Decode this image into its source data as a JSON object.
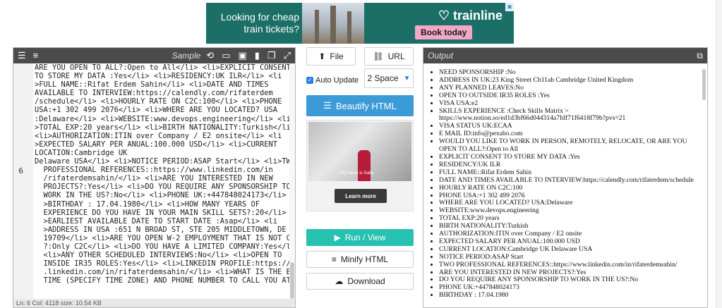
{
  "ad": {
    "text": "Looking for cheap train tickets?",
    "brand": "trainline",
    "cta": "Book today",
    "close_symbol": "✖"
  },
  "editor": {
    "sample_label": "Sample",
    "line_number": "6",
    "status": "Ln: 6   Col: 4118   size: 10.54 KB",
    "code_lines": [
      "ARE YOU OPEN TO ALL?:Open to All</li> <li>EXPLICIT CONSENT",
      "TO STORE MY DATA :Yes</li> <li>RESIDENCY:UK ILR</li> <li",
      ">FULL NAME::Rifat Erdem Sahin</li> <li>DATE AND TIMES",
      "AVAILABLE TO INTERVIEW:https://calendly.com/rifaterdem",
      "/schedule</li> <li>HOURLY RATE ON C2C:100</li> <li>PHONE",
      "USA:+1 302 499 2076</li> <li>WHERE ARE YOU LOCATED? USA",
      ":Delaware</li> <li>WEBSITE:www.devops.engineering</li> <li",
      ">TOTAL EXP:20 years</li> <li>BIRTH NATIONALITY:Turkish</li>",
      "<li>AUTHORIZATION:ITIN over Company / E2 onsite</li> <li",
      ">EXPECTED SALARY PER ANUAL:100.000 USD</li> <li>CURRENT",
      "LOCATION:Cambridge UK",
      "Delaware USA</li> <li>NOTICE PERIOD:ASAP Start</li> <li>TWO",
      "  PROFESSIONAL REFERENCES::https://www.linkedin.com/in",
      "  /rifaterdemsahin/</li> <li>ARE YOU INTERESTED IN NEW",
      "  PROJECTS?:Yes</li> <li>DO YOU REQUIRE ANY SPONSORSHIP TO",
      "  WORK IN THE US?:No</li> <li>PHONE UK:+447848024173</li> <li",
      "  >BIRTHDAY : 17.04.1980</li> <li>HOW MANY YEARS OF",
      "  EXPERIENCE DO YOU HAVE IN YOUR MAIN SKILL SETS?:20</li> <li",
      "  >EARLIEST AVAILABLE DATE TO START DATE :Asap</li> <li",
      "  >ADDRESS IN USA :651 N BROAD ST, STE 205 MIDDLETOWN, DE",
      "  19709</li> <li>ARE YOU OPEN W-2 EMPLOYMENT THAT IS NOT C2C",
      "  ?:Only C2C</li> <li>DO YOU HAVE A LIMITED COMPANY:Yes</li>",
      "  <li>ANY OTHER SCHEDULED INTERVIEWS:No</li> <li>OPEN TO",
      "  INSIDE IR35 ROLES:Yes</li> <li>LINKEDIN PROFILE:https://www",
      "  .linkedin.com/in/rifaterdemsahin/</li> <li>WHAT IS THE BEST",
      "  TIME (SPECIFY TIME ZONE) AND PHONE NUMBER TO CALL YOU AT"
    ]
  },
  "controls": {
    "file_label": "File",
    "url_label": "URL",
    "auto_update_label": "Auto Update",
    "indent_value": "2 Space",
    "beautify_label": "Beautify HTML",
    "run_label": "Run / View",
    "minify_label": "Minify HTML",
    "download_label": "Download"
  },
  "video_ad": {
    "caption": "Pity name is Gaby",
    "learn_more": "Learn more"
  },
  "output": {
    "title": "Output",
    "items": [
      "NEED SPONSORSHIP :No",
      "ADDRESS IN UK:23 King Street Cb11ah Cambridge United Kingdom",
      "ANY PLANNED LEAVES:No",
      "OPEN TO OUTSIDE IR35 ROLES :Yes",
      "VISA USA:e2",
      "SKILLS EXPERIENCE :Check Skills Matrix > https://www.notion.so/ed1d3bf66d044314a7fdf71f6418f79b?pvs=21",
      "VISA STATUS UK:ECAA",
      "E MAIL ID:info@pexabo.com",
      "WOULD YOU LIKE TO WORK IN PERSON, REMOTELY, RELOCATE, OR ARE YOU OPEN TO ALL?:Open to All",
      "EXPLICIT CONSENT TO STORE MY DATA :Yes",
      "RESIDENCY:UK ILR",
      "FULL NAME::Rifat Erdem Sahin",
      "DATE AND TIMES AVAILABLE TO INTERVIEW:https://calendly.com/rifaterdem/schedule",
      "HOURLY RATE ON C2C:100",
      "PHONE USA:+1 302 499 2076",
      "WHERE ARE YOU LOCATED? USA:Delaware",
      "WEBSITE:www.devops.engineering",
      "TOTAL EXP:20 years",
      "BIRTH NATIONALITY:Turkish",
      "AUTHORIZATION:ITIN over Company / E2 onsite",
      "EXPECTED SALARY PER ANUAL:100.000 USD",
      "CURRENT LOCATION:Cambridge UK Delaware USA",
      "NOTICE PERIOD:ASAP Start",
      "TWO PROFESSIONAL REFERENCES::https://www.linkedin.com/in/rifaterdemsahin/",
      "ARE YOU INTERESTED IN NEW PROJECTS?:Yes",
      "DO YOU REQUIRE ANY SPONSORSHIP TO WORK IN THE US?:No",
      "PHONE UK:+447848024173",
      "BIRTHDAY : 17.04.1980"
    ]
  },
  "colors": {
    "toolbar": "#4b4b4b",
    "beautify": "#3c9bd6",
    "run": "#26c1b0",
    "ad_background": "#1b6f67"
  }
}
